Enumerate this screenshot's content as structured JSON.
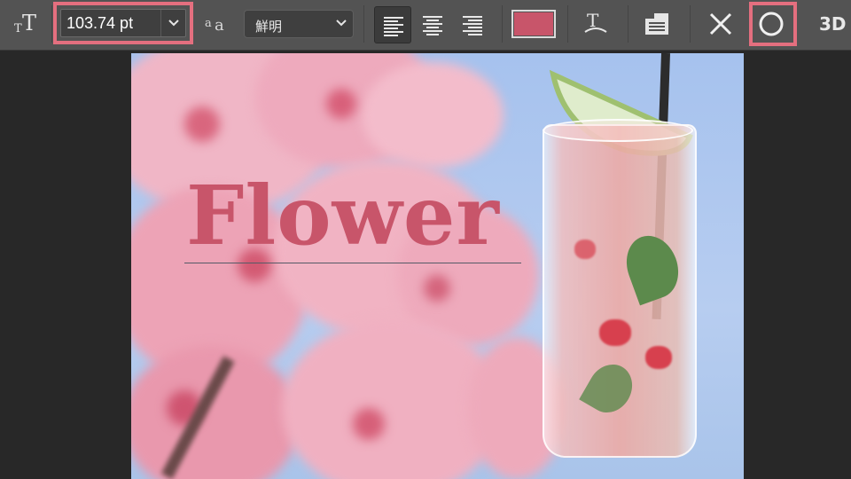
{
  "toolbar": {
    "tool_icon": "type-orientation-icon",
    "font_size": {
      "value": "103.74 pt",
      "highlighted": true
    },
    "antialias_icon": "antialias-aa-icon",
    "antialias_method": "鮮明",
    "align": {
      "options": [
        "align-left-icon",
        "align-center-icon",
        "align-right-icon"
      ],
      "selected": "align-left-icon"
    },
    "text_color": "#c8556a",
    "warp_icon": "warp-text-icon",
    "panels_icon": "character-panel-icon",
    "cancel_icon": "cancel-x-icon",
    "commit_icon": "commit-circle-icon",
    "commit_highlighted": true,
    "three_d_label": "3D"
  },
  "canvas": {
    "text_layer": "Flower",
    "text_color": "#c8556a",
    "image_subject": "cherry blossoms and strawberry mojito"
  },
  "colors": {
    "toolbar_bg": "#535353",
    "workspace_bg": "#282828",
    "highlight": "#e46f7f"
  }
}
